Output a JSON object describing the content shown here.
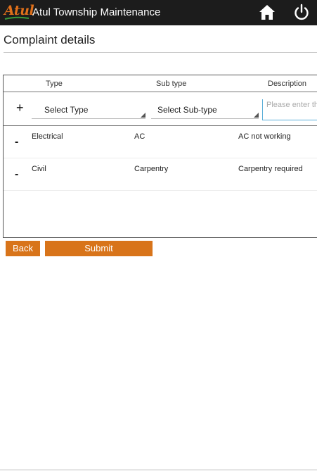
{
  "app": {
    "logo_text": "Atul",
    "title": "Atul Township Maintenance",
    "icons": {
      "home": "home-icon",
      "power": "power-icon"
    },
    "colors": {
      "appbar": "#1c1c1c",
      "accent": "#d8741a",
      "focus": "#5aaed8"
    }
  },
  "page": {
    "title": "Complaint details"
  },
  "table": {
    "headers": {
      "type": "Type",
      "subtype": "Sub type",
      "description": "Description"
    },
    "form": {
      "add_label": "+",
      "type_value": "Select Type",
      "subtype_value": "Select Sub-type",
      "description_placeholder": "Please enter the details"
    },
    "rows": [
      {
        "remove_label": "-",
        "type": "Electrical",
        "subtype": "AC",
        "description": "AC not working"
      },
      {
        "remove_label": "-",
        "type": "Civil",
        "subtype": "Carpentry",
        "description": "Carpentry required"
      }
    ]
  },
  "actions": {
    "back_label": "Back",
    "submit_label": "Submit"
  }
}
